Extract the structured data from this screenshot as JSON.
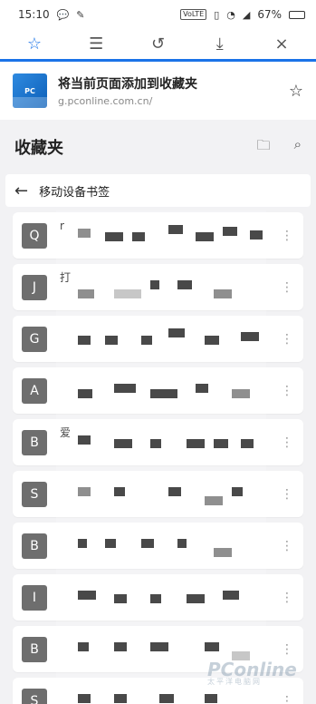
{
  "status": {
    "time": "15:10",
    "battery": "67%",
    "net_badge": "VoLTE"
  },
  "toolbar": {
    "tabs": [
      {
        "name": "favorites"
      },
      {
        "name": "reading-list"
      },
      {
        "name": "history"
      },
      {
        "name": "downloads"
      }
    ],
    "close": "×"
  },
  "add_favorite": {
    "title": "将当前页面添加到收藏夹",
    "url": "g.pconline.com.cn/"
  },
  "section": {
    "title": "收藏夹"
  },
  "folder": {
    "name": "移动设备书签"
  },
  "items": [
    {
      "letter": "Q",
      "title": "r"
    },
    {
      "letter": "J",
      "title": "打"
    },
    {
      "letter": "G",
      "title": ""
    },
    {
      "letter": "A",
      "title": ""
    },
    {
      "letter": "B",
      "title": "爱"
    },
    {
      "letter": "S",
      "title": ""
    },
    {
      "letter": "B",
      "title": ""
    },
    {
      "letter": "I",
      "title": ""
    },
    {
      "letter": "B",
      "title": ""
    },
    {
      "letter": "S",
      "title": ""
    }
  ],
  "watermark": {
    "text": "PConline",
    "subtext": "太平洋电脑网"
  }
}
